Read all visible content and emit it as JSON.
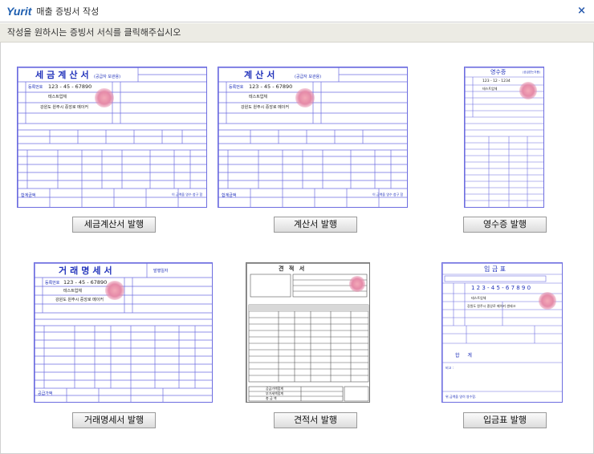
{
  "window": {
    "logo": "Yurit",
    "title": "매출 증빙서 작성",
    "close_glyph": "×"
  },
  "instruction": "작성을 원하시는 증빙서 서식를 클릭해주십시오",
  "forms": [
    {
      "button": "세금계산서 발행",
      "title": "세금계산서",
      "subtitle": "(공급자 보관용)",
      "reg_label": "등록번호",
      "reg_no": "123 - 45 - 67890",
      "company": "테스트업체",
      "address": "강원도 원주시 중앙로 메이커",
      "foot_label": "합계금액",
      "receipt": "이 금액을 영수 청구 함"
    },
    {
      "button": "계산서 발행",
      "title": "계산서",
      "subtitle": "(공급자 보관용)",
      "reg_label": "등록번호",
      "reg_no": "123 - 45 - 67890",
      "company": "테스트업체",
      "address": "강원도 원주시 중앙로 메이커",
      "foot_label": "합계금액",
      "receipt": "이 금액을 영수 청구 함"
    },
    {
      "button": "영수증 발행",
      "title": "영수증",
      "subtitle": "(공급받는자용)",
      "reg_no": "123 - 12 - 1234",
      "company": "테스트업체"
    },
    {
      "button": "거래명세서 발행",
      "title": "거래명세서",
      "date_label": "발행일자",
      "reg_label": "등록번호",
      "reg_no": "123 - 45 - 67890",
      "company": "테스트업체",
      "address": "강원도 원주시 중앙로 메이커",
      "foot_label": "공급가액"
    },
    {
      "button": "견적서 발행",
      "title": "견 적 서",
      "foot_rows": [
        "공급가액합계",
        "부가세액합계",
        "총 금 액"
      ]
    },
    {
      "button": "입금표 발행",
      "title": "입 금 표",
      "reg_no": "1 2 3 - 4 5 - 6 7 8 9 0",
      "company": "테스트업체",
      "address": "강원도 원주시 중앙로 메이커 센테크",
      "sum_label": "합 계",
      "note_label": "비고 :",
      "footer": "위 금액을 영히 영수함."
    }
  ],
  "colors": {
    "form_line": "#6d6de0",
    "form_text": "#2233bb",
    "logo": "#1f5fb0",
    "stamp": "#e58aa8"
  }
}
